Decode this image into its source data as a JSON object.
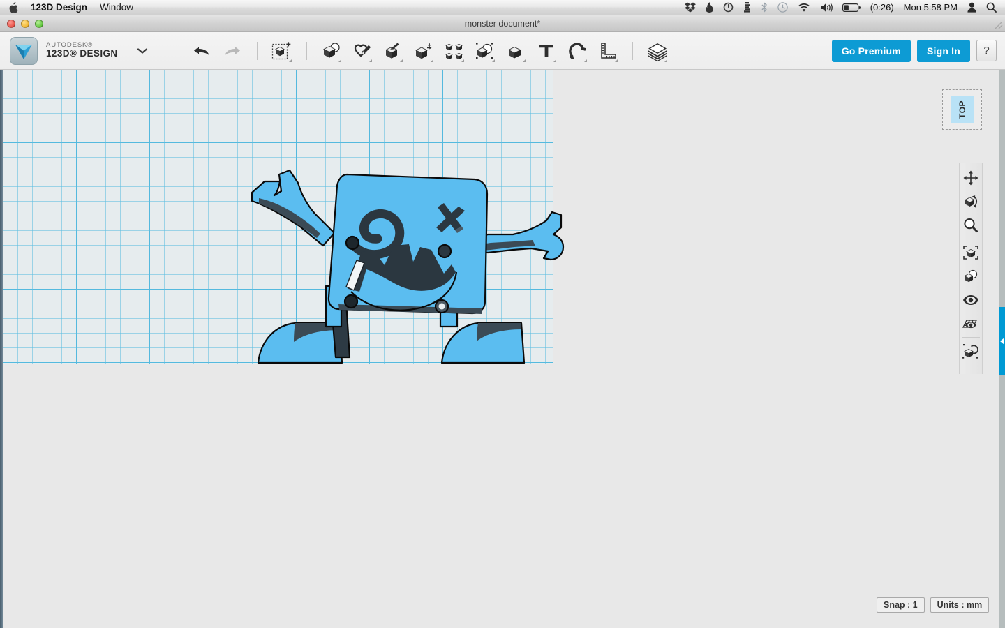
{
  "menubar": {
    "apple_icon": "apple-icon",
    "app_name": "123D Design",
    "menus": [
      "Window"
    ],
    "status_icons": [
      "dropbox-icon",
      "flame-icon",
      "clock-icon",
      "chess-pawn-icon",
      "bluetooth-icon",
      "time-machine-icon",
      "wifi-icon",
      "volume-icon",
      "battery-icon"
    ],
    "battery_time": "(0:26)",
    "clock": "Mon 5:58 PM",
    "user_icon": "user-icon",
    "spotlight_icon": "search-icon"
  },
  "window": {
    "title": "monster document*",
    "close_label": "close",
    "minimize_label": "minimize",
    "zoom_label": "zoom"
  },
  "brand": {
    "line1": "AUTODESK®",
    "line2": "123D® DESIGN",
    "dropdown_icon": "chevron-down-icon"
  },
  "toolbar": {
    "items": [
      {
        "name": "undo-button",
        "icon": "undo-arrow-icon",
        "label": "Undo",
        "enabled": true
      },
      {
        "name": "redo-button",
        "icon": "redo-arrow-icon",
        "label": "Redo",
        "enabled": false
      },
      {
        "name": "transform-button",
        "icon": "transform-cube-icon",
        "label": "Transform"
      },
      {
        "name": "primitives-button",
        "icon": "primitives-icon",
        "label": "Primitives"
      },
      {
        "name": "sketch-button",
        "icon": "sketch-pen-icon",
        "label": "Sketch"
      },
      {
        "name": "construct-button",
        "icon": "construct-icon",
        "label": "Construct"
      },
      {
        "name": "modify-button",
        "icon": "modify-icon",
        "label": "Modify"
      },
      {
        "name": "pattern-button",
        "icon": "pattern-icon",
        "label": "Pattern"
      },
      {
        "name": "grouping-button",
        "icon": "grouping-icon",
        "label": "Grouping"
      },
      {
        "name": "combine-button",
        "icon": "combine-icon",
        "label": "Combine"
      },
      {
        "name": "text-button",
        "icon": "text-t-icon",
        "label": "Text"
      },
      {
        "name": "snap-button",
        "icon": "magnet-icon",
        "label": "Snap"
      },
      {
        "name": "measure-button",
        "icon": "ruler-icon",
        "label": "Measure"
      },
      {
        "name": "materials-button",
        "icon": "material-stack-icon",
        "label": "Material"
      }
    ],
    "go_premium_label": "Go Premium",
    "sign_in_label": "Sign In",
    "help_label": "?"
  },
  "viewcube": {
    "face_label": "TOP"
  },
  "navbar": {
    "items": [
      {
        "name": "pan-tool",
        "icon": "pan-arrows-icon",
        "label": "Pan"
      },
      {
        "name": "orbit-tool",
        "icon": "orbit-cube-icon",
        "label": "Orbit"
      },
      {
        "name": "zoom-tool",
        "icon": "magnifier-icon",
        "label": "Zoom"
      },
      {
        "name": "fit-tool",
        "icon": "fit-cube-icon",
        "label": "Fit"
      },
      {
        "name": "hide-tool",
        "icon": "hide-cube-icon",
        "label": "Hide"
      },
      {
        "name": "visibility-tool",
        "icon": "eye-icon",
        "label": "Show/Hide"
      },
      {
        "name": "grid-display-tool",
        "icon": "grid-eye-icon",
        "label": "Grid Display"
      },
      {
        "name": "snap-object-tool",
        "icon": "snap-object-icon",
        "label": "Snap"
      }
    ]
  },
  "panel_tab": {
    "icon": "chevron-left-icon",
    "label": "expand-panel"
  },
  "status": {
    "snap": "Snap : 1",
    "units": "Units : mm"
  },
  "scene": {
    "object_name": "monster",
    "body_color": "#5bbdf0",
    "shadow_color": "#3b4a55",
    "outline_color": "#0a0a0a",
    "grid_background": "#e6ecee",
    "grid_line_color": "#5bbee1",
    "features": [
      "spiral-eye",
      "x-eye",
      "jagged-frown-mouth",
      "left-wrench-arm",
      "right-wrench-arm",
      "left-foot",
      "right-foot",
      "four-bolts"
    ]
  }
}
